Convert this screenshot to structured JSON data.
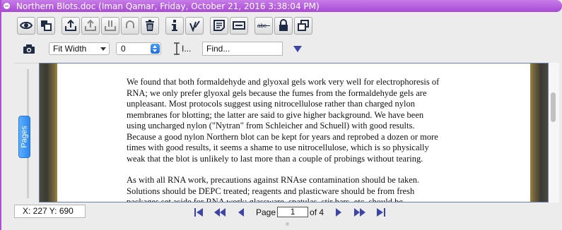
{
  "window": {
    "title": "Northern Blots.doc (Iman Qamar, Friday, October 21, 2016 3:38:04 PM)"
  },
  "toolbar": {
    "groups": [
      [
        "eye-icon",
        "layers-icon"
      ],
      [
        "upload-icon",
        "upload-alt-icon",
        "upload-merge-icon",
        "undo-icon",
        "trash-icon"
      ],
      [
        "info-icon",
        "signature-icon"
      ],
      [
        "note-icon",
        "form-icon"
      ],
      [
        "strikethrough-icon",
        "lock-icon",
        "window-icon"
      ]
    ]
  },
  "options": {
    "zoom_value": "Fit Width",
    "rotation_value": "0",
    "find_placeholder": "Find...",
    "cursor_tool_label": "I..."
  },
  "side_panel": {
    "tab_label": "Pages"
  },
  "document": {
    "paragraphs": [
      {
        "lines": [
          "We found that both formaldehyde and glyoxal gels work very well for electrophoresis of",
          "RNA; we only prefer glyoxal gels because the fumes from the formaldehyde gels are",
          "unpleasant. Most protocols suggest using nitrocellulose rather than charged nylon",
          "membranes for blotting; the latter are said to give higher background. We have been",
          "using uncharged nylon (\"Nytran\" from Schleicher and Schuell) with good results.",
          "Because a good nylon Northern blot can be kept for years and reprobed a dozen or more",
          "times with good results, it seems a shame to use nitrocellulose, which is so physically",
          "weak that the blot is unlikely to last more than a couple of probings without tearing."
        ]
      },
      {
        "lines": [
          "As with all RNA work, precautions against RNAse contamination should be taken.",
          "Solutions should be DEPC treated; reagents and plasticware should be from fresh",
          "packages set aside for RNA work; glassware, spatulas, stir bars, etc. should be"
        ]
      }
    ]
  },
  "status": {
    "coords": "X: 227 Y: 690",
    "page_label": "Page",
    "page_value": "1",
    "page_total_label": "of 4"
  },
  "colors": {
    "title_bar": "#a94ad6",
    "icon_dark": "#1f2a44",
    "nav_blue": "#3b45a8"
  }
}
